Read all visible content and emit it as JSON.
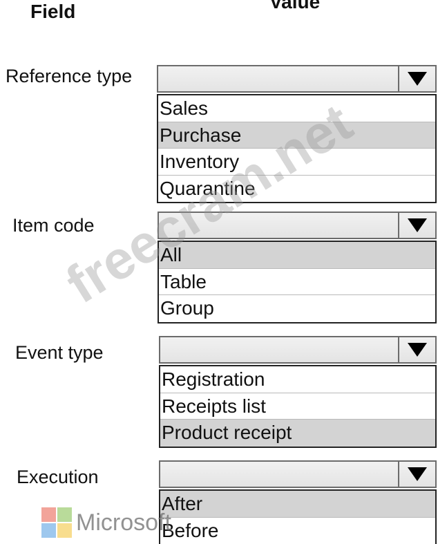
{
  "header": {
    "field": "Field",
    "value": "Value"
  },
  "rows": [
    {
      "label": "Reference type",
      "options": [
        "Sales",
        "Purchase",
        "Inventory",
        "Quarantine"
      ],
      "selected_index": 1
    },
    {
      "label": "Item code",
      "options": [
        "All",
        "Table",
        "Group"
      ],
      "selected_index": 0
    },
    {
      "label": "Event type",
      "options": [
        "Registration",
        "Receipts list",
        "Product receipt"
      ],
      "selected_index": 2
    },
    {
      "label": "Execution",
      "options": [
        "After",
        "Before"
      ],
      "selected_index": 0
    }
  ],
  "watermark": "freecram.net",
  "logo": {
    "text": "Microsoft",
    "colors": [
      "#f2a49a",
      "#b9db9a",
      "#9ec8ee",
      "#f8dd8e"
    ]
  }
}
